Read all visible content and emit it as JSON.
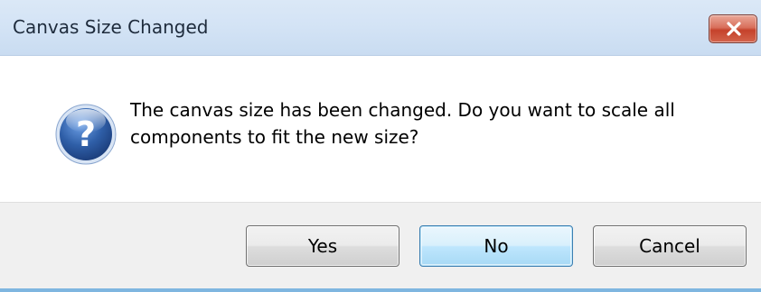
{
  "dialog": {
    "title": "Canvas Size Changed",
    "message": "The canvas size has been changed. Do you want to scale all components to fit the new size?",
    "icon": "question-icon",
    "buttons": {
      "yes": "Yes",
      "no": "No",
      "cancel": "Cancel"
    },
    "default_button": "no"
  },
  "colors": {
    "title_bar": "#d3e3f5",
    "close_button": "#c5422b",
    "footer": "#f0f0f0",
    "icon_blue": "#2f5fa8"
  }
}
